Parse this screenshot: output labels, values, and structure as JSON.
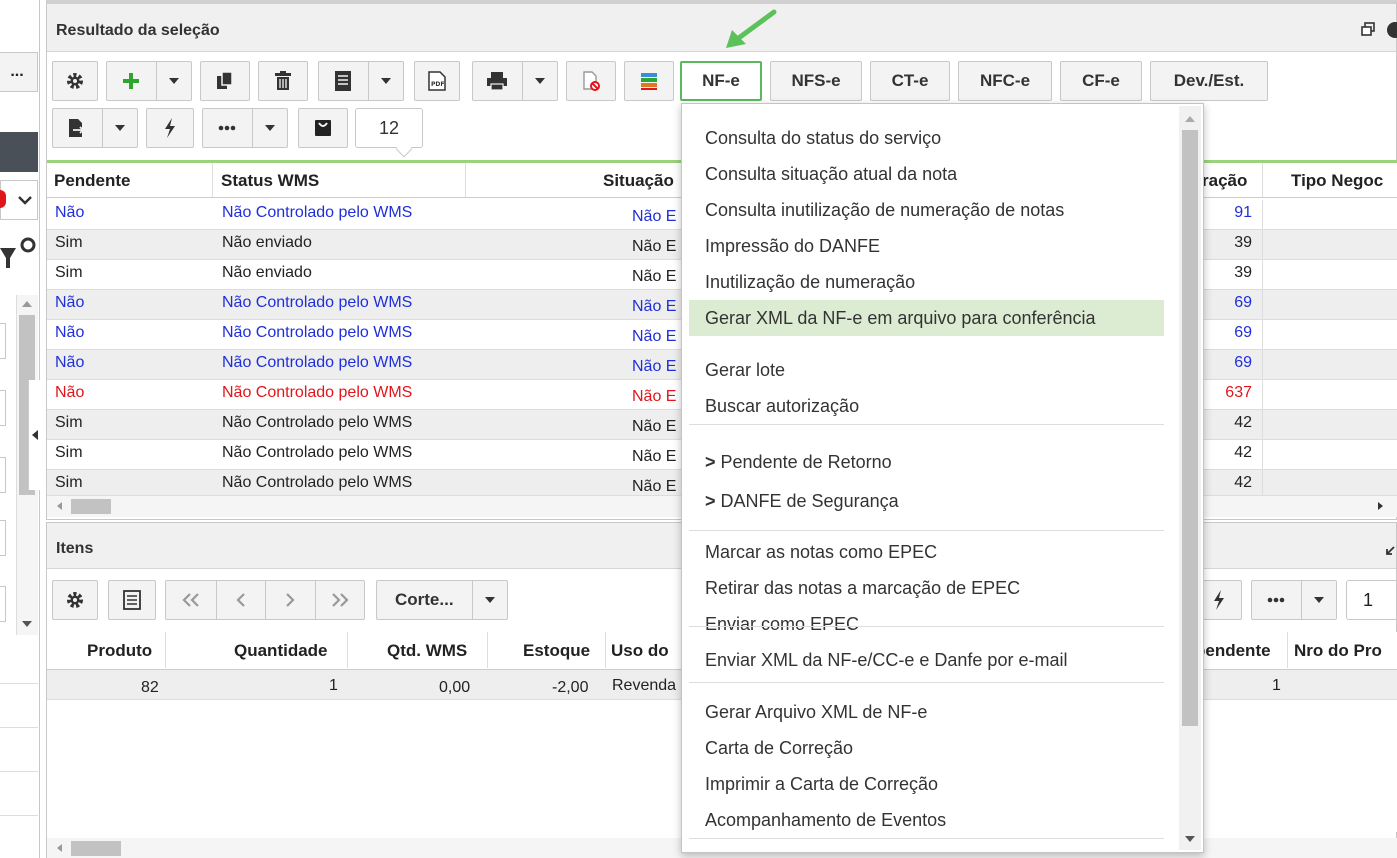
{
  "top_panel": {
    "title": "Resultado da seleção",
    "doc_tabs": [
      "NF-e",
      "NFS-e",
      "CT-e",
      "NFC-e",
      "CF-e",
      "Dev./Est."
    ],
    "counter_value": "12"
  },
  "left_panel": {
    "dots_label": "..."
  },
  "main_grid": {
    "columns": [
      "Pendente",
      "Status WMS",
      "Situação",
      "ração",
      "Tipo Negoc"
    ],
    "rows": [
      {
        "pendente": "Não",
        "status": "Não Controlado pelo WMS",
        "situacao": "Não E",
        "num": "91",
        "color": "blue"
      },
      {
        "pendente": "Sim",
        "status": "Não enviado",
        "situacao": "Não E",
        "num": "39",
        "color": "black"
      },
      {
        "pendente": "Sim",
        "status": "Não enviado",
        "situacao": "Não E",
        "num": "39",
        "color": "black"
      },
      {
        "pendente": "Não",
        "status": "Não Controlado pelo WMS",
        "situacao": "Não E",
        "num": "69",
        "color": "blue"
      },
      {
        "pendente": "Não",
        "status": "Não Controlado pelo WMS",
        "situacao": "Não E",
        "num": "69",
        "color": "blue"
      },
      {
        "pendente": "Não",
        "status": "Não Controlado pelo WMS",
        "situacao": "Não E",
        "num": "69",
        "color": "blue"
      },
      {
        "pendente": "Não",
        "status": "Não Controlado pelo WMS",
        "situacao": "Não E",
        "num": "637",
        "color": "red"
      },
      {
        "pendente": "Sim",
        "status": "Não Controlado pelo WMS",
        "situacao": "Não E",
        "num": "42",
        "color": "black"
      },
      {
        "pendente": "Sim",
        "status": "Não Controlado pelo WMS",
        "situacao": "Não E",
        "num": "42",
        "color": "black"
      },
      {
        "pendente": "Sim",
        "status": "Não Controlado pelo WMS",
        "situacao": "Não E",
        "num": "42",
        "color": "black"
      }
    ]
  },
  "items_panel": {
    "title": "Itens",
    "corte_label": "Corte...",
    "page_value": "1",
    "columns": [
      "Produto",
      "Quantidade",
      "Qtd. WMS",
      "Estoque",
      "Uso do",
      "pendente",
      "Nro do Pro"
    ],
    "row": {
      "produto": "82",
      "quantidade": "1",
      "qtd_wms": "0,00",
      "estoque": "-2,00",
      "uso": "Revenda",
      "pendente": "1"
    }
  },
  "nfe_menu": {
    "items": [
      "Consulta do status do serviço",
      "Consulta situação atual da nota",
      "Consulta inutilização de numeração de notas",
      "Impressão do DANFE",
      "Inutilização de numeração",
      "Gerar XML da NF-e em arquivo para conferência",
      "Gerar lote",
      "Buscar autorização",
      "Pendente de Retorno",
      "DANFE de Segurança",
      "Marcar as notas como EPEC",
      "Retirar das notas a marcação de EPEC",
      "Enviar como EPEC",
      "Enviar XML da NF-e/CC-e e Danfe por e-mail",
      "Gerar Arquivo XML de NF-e",
      "Carta de Correção",
      "Imprimir a Carta de Correção",
      "Acompanhamento de Eventos"
    ],
    "submenu_marker": ">"
  },
  "colors": {
    "accent_green": "#5cb85c",
    "highlight": "#dcecd2",
    "link_blue": "#1f2fd8",
    "alert_red": "#e0161b"
  }
}
